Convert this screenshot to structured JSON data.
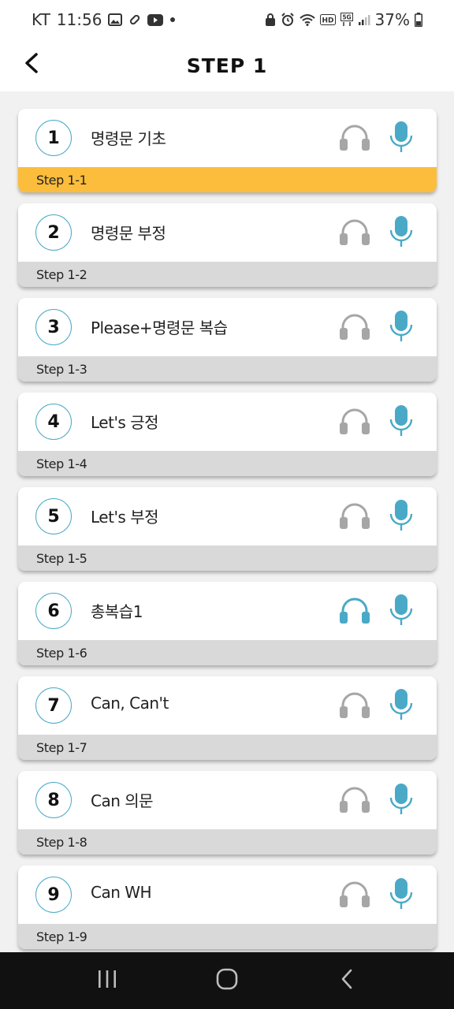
{
  "status_bar": {
    "carrier": "KT",
    "time": "11:56",
    "battery": "37%"
  },
  "header": {
    "title": "STEP 1"
  },
  "colors": {
    "accent": "#4aa9c7",
    "icon_inactive": "#a6a6a6",
    "active_footer": "#fbbd3b",
    "footer": "#d9d9d9"
  },
  "lessons": [
    {
      "number": "1",
      "title": "명령문 기초",
      "step": "Step 1-1",
      "active": true,
      "headphone_active": false
    },
    {
      "number": "2",
      "title": "명령문 부정",
      "step": "Step 1-2",
      "active": false,
      "headphone_active": false
    },
    {
      "number": "3",
      "title": "Please+명령문 복습",
      "step": "Step 1-3",
      "active": false,
      "headphone_active": false
    },
    {
      "number": "4",
      "title": "Let's 긍정",
      "step": "Step 1-4",
      "active": false,
      "headphone_active": false
    },
    {
      "number": "5",
      "title": "Let's 부정",
      "step": "Step 1-5",
      "active": false,
      "headphone_active": false
    },
    {
      "number": "6",
      "title": "총복습1",
      "step": "Step 1-6",
      "active": false,
      "headphone_active": true
    },
    {
      "number": "7",
      "title": "Can, Can't",
      "step": "Step 1-7",
      "active": false,
      "headphone_active": false
    },
    {
      "number": "8",
      "title": "Can 의문",
      "step": "Step 1-8",
      "active": false,
      "headphone_active": false
    },
    {
      "number": "9",
      "title": "Can WH",
      "step": "Step 1-9",
      "active": false,
      "headphone_active": false
    }
  ],
  "icons": {
    "back": "chevron-left-icon",
    "headphone": "headphone-icon",
    "mic": "microphone-icon",
    "nav_recents": "recents-icon",
    "nav_home": "home-icon",
    "nav_back": "back-icon"
  }
}
